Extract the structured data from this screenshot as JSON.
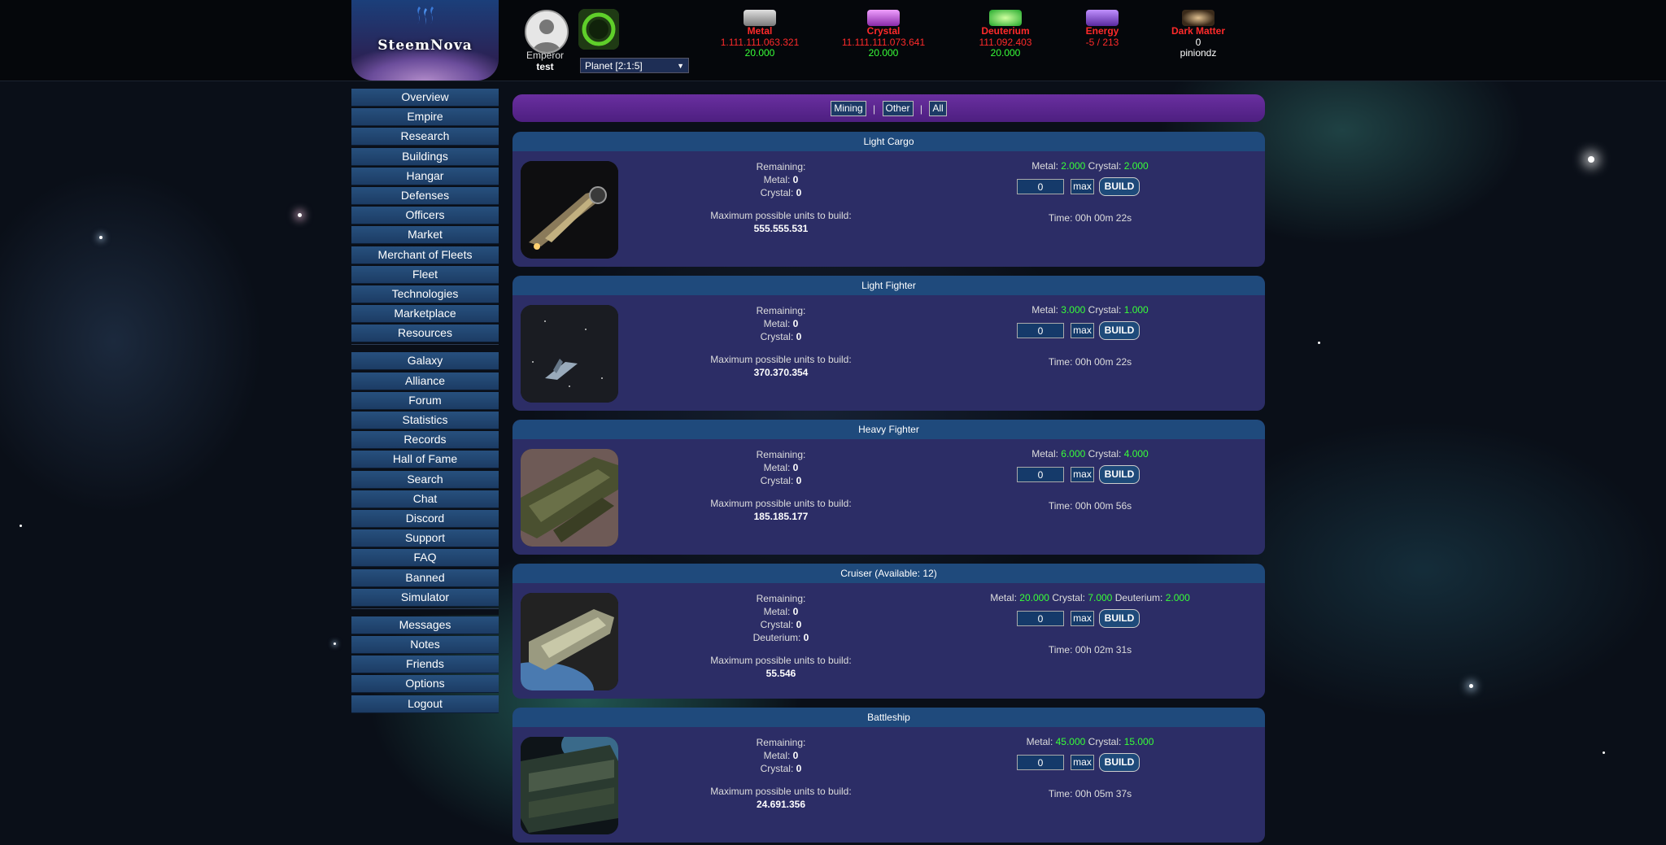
{
  "header": {
    "logo_text": "SteemNova",
    "user": {
      "label": "Emperor",
      "name": "test"
    },
    "planet_select": "Planet [2:1:5]",
    "resources": [
      {
        "name": "Metal",
        "amount": "1.111.111.063.321",
        "production": "20.000",
        "color": "#b5b5b5"
      },
      {
        "name": "Crystal",
        "amount": "11.111.111.073.641",
        "production": "20.000",
        "color": "#c85adc"
      },
      {
        "name": "Deuterium",
        "amount": "111.092.403",
        "production": "20.000",
        "color": "#2ecc40"
      },
      {
        "name": "Energy",
        "amount": "-5 / 213",
        "production": "",
        "color": "#9b59d0"
      },
      {
        "name": "Dark Matter",
        "amount": "0",
        "production": "piniondz",
        "color": "#806040"
      }
    ]
  },
  "sidebar": {
    "groups": [
      [
        "Overview",
        "Empire",
        "Research",
        "Buildings",
        "Hangar",
        "Defenses",
        "Officers",
        "Market",
        "Merchant of Fleets",
        "Fleet",
        "Technologies",
        "Marketplace",
        "Resources"
      ],
      [
        "Galaxy",
        "Alliance",
        "Forum",
        "Statistics",
        "Records",
        "Hall of Fame",
        "Search",
        "Chat",
        "Discord",
        "Support",
        "FAQ",
        "Banned",
        "Simulator"
      ],
      [
        "Messages",
        "Notes",
        "Friends",
        "Options",
        "Logout"
      ]
    ]
  },
  "filters": {
    "mining": "Mining",
    "other": "Other",
    "all": "All",
    "separator": "|"
  },
  "labels": {
    "remaining": "Remaining:",
    "metal": "Metal:",
    "crystal": "Crystal:",
    "deuterium": "Deuterium:",
    "max_units": "Maximum possible units to build:",
    "max_button": "max",
    "build_button": "BUILD",
    "qty_default": "0"
  },
  "units": [
    {
      "name": "Light Cargo",
      "remaining": {
        "metal": "0",
        "crystal": "0"
      },
      "max_units": "555.555.531",
      "cost": {
        "metal": "2.000",
        "crystal": "2.000"
      },
      "time": "Time: 00h 00m 22s"
    },
    {
      "name": "Light Fighter",
      "remaining": {
        "metal": "0",
        "crystal": "0"
      },
      "max_units": "370.370.354",
      "cost": {
        "metal": "3.000",
        "crystal": "1.000"
      },
      "time": "Time: 00h 00m 22s"
    },
    {
      "name": "Heavy Fighter",
      "remaining": {
        "metal": "0",
        "crystal": "0"
      },
      "max_units": "185.185.177",
      "cost": {
        "metal": "6.000",
        "crystal": "4.000"
      },
      "time": "Time: 00h 00m 56s"
    },
    {
      "name": "Cruiser (Available: 12)",
      "remaining": {
        "metal": "0",
        "crystal": "0",
        "deuterium": "0"
      },
      "max_units": "55.546",
      "cost": {
        "metal": "20.000",
        "crystal": "7.000",
        "deuterium": "2.000"
      },
      "time": "Time: 00h 02m 31s"
    },
    {
      "name": "Battleship",
      "remaining": {
        "metal": "0",
        "crystal": "0"
      },
      "max_units": "24.691.356",
      "cost": {
        "metal": "45.000",
        "crystal": "15.000"
      },
      "time": "Time: 00h 05m 37s"
    }
  ]
}
